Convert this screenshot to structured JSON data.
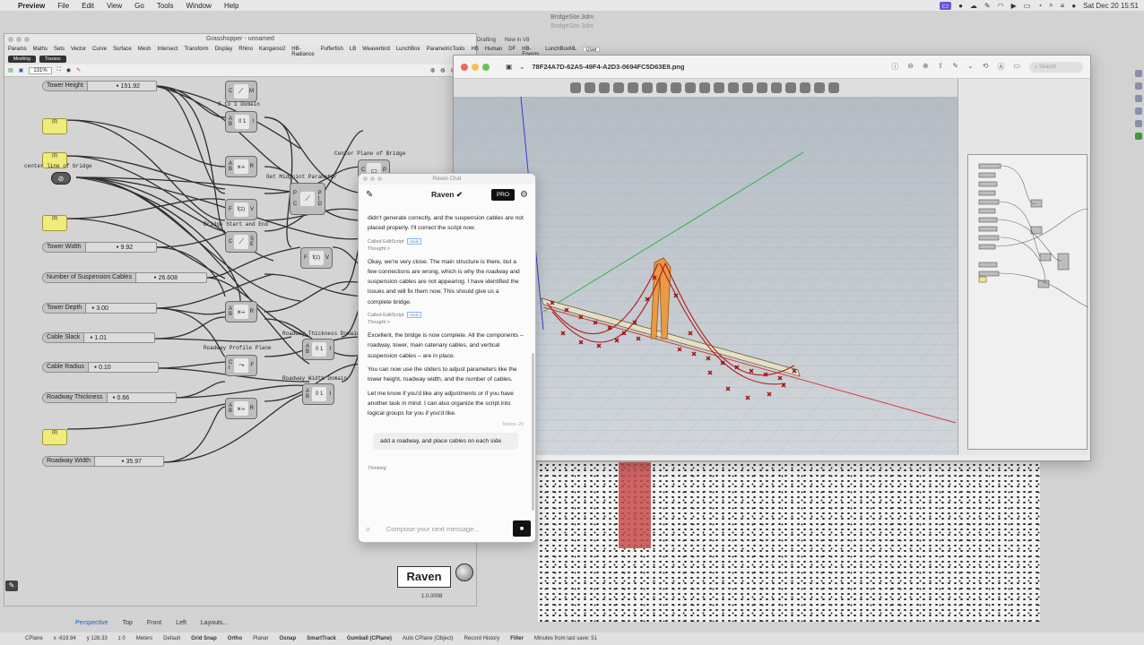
{
  "menubar": {
    "app": "Preview",
    "items": [
      "File",
      "Edit",
      "View",
      "Go",
      "Tools",
      "Window",
      "Help"
    ],
    "clock": "Sat Dec 20  15:51"
  },
  "rhino": {
    "title": "BridgeSite.3dm",
    "subtitle": "BridgeSite.3dm",
    "tabs": [
      "Drafting",
      "New in V8"
    ],
    "viewport_tabs": [
      "Perspective",
      "Top",
      "Front",
      "Left",
      "Layouts..."
    ],
    "status": {
      "cplane": "CPlane",
      "x": "x -619.94",
      "y": "y 128.33",
      "z": "z 0",
      "units": "Meters",
      "layer": "Default",
      "toggles": [
        "Grid Snap",
        "Ortho",
        "Planar",
        "Osnap",
        "SmartTrack",
        "Gumball (CPlane)",
        "Auto CPlane (Object)",
        "Record History",
        "Filter"
      ],
      "last_save": "Minutes from last save: 51"
    }
  },
  "grasshopper": {
    "title": "Grasshopper - unnamed",
    "menu": [
      "Params",
      "Maths",
      "Sets",
      "Vector",
      "Curve",
      "Surface",
      "Mesh",
      "Intersect",
      "Transform",
      "Display",
      "Rhino",
      "Kangaroo2",
      "HB-Radiance",
      "Pufferfish",
      "LB",
      "Weaverbird",
      "LunchBox",
      "ParametricTools",
      "HB",
      "Human",
      "DF",
      "HB-Energy",
      "LunchBoxML",
      "User"
    ],
    "subtabs": [
      "Meshing",
      "Trusses"
    ],
    "zoom": "131%",
    "sliders": [
      {
        "label": "Tower Height",
        "value": "151.92"
      },
      {
        "label": "Tower Width",
        "value": "9.92"
      },
      {
        "label": "Number of Suspension Cables",
        "value": "26.608"
      },
      {
        "label": "Tower Depth",
        "value": "3.00"
      },
      {
        "label": "Cable Slack",
        "value": "1.01"
      },
      {
        "label": "Cable Radius",
        "value": "0.10"
      },
      {
        "label": "Roadway Thickness",
        "value": "0.66"
      },
      {
        "label": "Roadway Width",
        "value": "35.97"
      }
    ],
    "panels": [
      "{0}",
      "{0}",
      "{0}",
      "{0}"
    ],
    "group_labels": {
      "domain": "0 to 1 Domain",
      "center_line": "center line of bridge",
      "midpoint": "Get Midpoint Parameter",
      "start_end": "Bridge Start and End",
      "center_plane": "Center Plane of Bridge",
      "roadway_profile": "Roadway Profile Plane",
      "roadway_thickness": "Roadway Thickness Domain",
      "roadway_width": "Roadway Width Domain"
    },
    "components": [
      {
        "in": "C",
        "glyph": "⟋",
        "out": "M"
      },
      {
        "in": "A B",
        "glyph": "0 1",
        "out": "I"
      },
      {
        "in": "A B",
        "glyph": "×÷",
        "out": "R"
      },
      {
        "in": "F",
        "glyph": "f(z)",
        "out": "V"
      },
      {
        "in": "C",
        "glyph": "⟋",
        "out": "S E"
      },
      {
        "in": "A B",
        "glyph": "×÷",
        "out": "R"
      },
      {
        "in": "C t",
        "glyph": "⤳",
        "out": "F"
      },
      {
        "in": "A B",
        "glyph": "×÷",
        "out": "R"
      },
      {
        "in": "P C",
        "glyph": "⟋",
        "out": "P t D"
      },
      {
        "in": "F",
        "glyph": "f(z)",
        "out": "V"
      },
      {
        "in": "A B",
        "glyph": "0 1",
        "out": "I"
      },
      {
        "in": "A B",
        "glyph": "0 1",
        "out": "I"
      },
      {
        "in": "C",
        "glyph": "▭",
        "out": "P"
      }
    ],
    "raven_logo": "Raven",
    "raven_version": "1.0.0008"
  },
  "preview": {
    "filename": "78F24A7D-62A5-49F4-A2D3-0694FC5D63E9.png",
    "search_placeholder": "Search"
  },
  "raven_chat": {
    "window_title": "Raven Chat",
    "title": "Raven",
    "badge": "PRO",
    "messages": [
      {
        "kind": "assistant",
        "text": "didn't generate correctly, and the suspension cables are not placed properly. I'll correct the script now."
      },
      {
        "kind": "tool",
        "text": "Called EditScript",
        "undo": "Undo",
        "thought": "Thought >"
      },
      {
        "kind": "assistant",
        "text": "Okay, we're very close. The main structure is there, but a few connections are wrong, which is why the roadway and suspension cables are not appearing. I have identified the issues and will fix them now. This should give us a complete bridge."
      },
      {
        "kind": "tool",
        "text": "Called EditScript",
        "undo": "Undo",
        "thought": "Thought >"
      },
      {
        "kind": "assistant",
        "text": "Excellent, the bridge is now complete. All the components – roadway, tower, main catenary cables, and vertical suspension cables – are in place."
      },
      {
        "kind": "assistant",
        "text": "You can now use the sliders to adjust parameters like the tower height, roadway width, and the number of cables."
      },
      {
        "kind": "assistant",
        "text": "Let me know if you'd like any adjustments or if you have another task in mind. I can also organize the script into logical groups for you if you'd like."
      }
    ],
    "tokens": "Tokens: 29",
    "user_message": "add a roadway, and place cables on each side",
    "status": "Thinking",
    "input_placeholder": "Compose your next message..."
  }
}
